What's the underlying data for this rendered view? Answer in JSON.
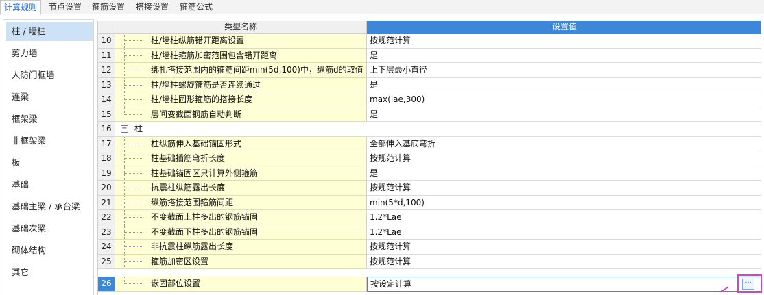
{
  "tabs": [
    {
      "label": "计算规则",
      "active": true
    },
    {
      "label": "节点设置",
      "active": false
    },
    {
      "label": "箍筋设置",
      "active": false
    },
    {
      "label": "搭接设置",
      "active": false
    },
    {
      "label": "箍筋公式",
      "active": false
    }
  ],
  "sidebar": {
    "items": [
      {
        "label": "柱 / 墙柱",
        "active": true
      },
      {
        "label": "剪力墙"
      },
      {
        "label": "人防门框墙"
      },
      {
        "label": "连梁"
      },
      {
        "label": "框架梁"
      },
      {
        "label": "非框架梁"
      },
      {
        "label": "板"
      },
      {
        "label": "基础"
      },
      {
        "label": "基础主梁 / 承台梁"
      },
      {
        "label": "基础次梁"
      },
      {
        "label": "砌体结构"
      },
      {
        "label": "其它"
      }
    ]
  },
  "grid": {
    "headers": {
      "name": "类型名称",
      "value": "设置值"
    },
    "rows": [
      {
        "num": "10",
        "name": "柱/墙柱纵筋错开距离设置",
        "value": "按规范计算"
      },
      {
        "num": "11",
        "name": "柱/墙柱箍筋加密范围包含错开距离",
        "value": "是"
      },
      {
        "num": "12",
        "name": "绑扎搭接范围内的箍筋间距min(5d,100)中，纵筋d的取值",
        "value": "上下层最小直径"
      },
      {
        "num": "13",
        "name": "柱/墙柱螺旋箍筋是否连续通过",
        "value": "是"
      },
      {
        "num": "14",
        "name": "柱/墙柱圆形箍筋的搭接长度",
        "value": "max(lae,300)"
      },
      {
        "num": "15",
        "name": "层间变截面钢筋自动判断",
        "value": "是"
      },
      {
        "num": "16",
        "name": "柱",
        "value": "",
        "group": true
      },
      {
        "num": "17",
        "name": "柱纵筋伸入基础锚固形式",
        "value": "全部伸入基底弯折"
      },
      {
        "num": "18",
        "name": "柱基础插筋弯折长度",
        "value": "按规范计算"
      },
      {
        "num": "19",
        "name": "柱基础锚固区只计算外侧箍筋",
        "value": "是"
      },
      {
        "num": "20",
        "name": "抗震柱纵筋露出长度",
        "value": "按规范计算"
      },
      {
        "num": "21",
        "name": "纵筋搭接范围箍筋间距",
        "value": "min(5*d,100)"
      },
      {
        "num": "22",
        "name": "不变截面上柱多出的钢筋锚固",
        "value": "1.2*Lae"
      },
      {
        "num": "23",
        "name": "不变截面下柱多出的钢筋锚固",
        "value": "1.2*Lae"
      },
      {
        "num": "24",
        "name": "非抗震柱纵筋露出长度",
        "value": "按规范计算"
      },
      {
        "num": "25",
        "name": "箍筋加密区设置",
        "value": "按规范计算"
      },
      {
        "num": "26",
        "name": "嵌固部位设置",
        "value": "按设定计算",
        "selected": true
      }
    ]
  },
  "icons": {
    "collapse": "−",
    "more": "···"
  },
  "colors": {
    "accent": "#3d86d8",
    "name_cell_bg": "#ffffd6",
    "highlight": "#d63fd6"
  }
}
